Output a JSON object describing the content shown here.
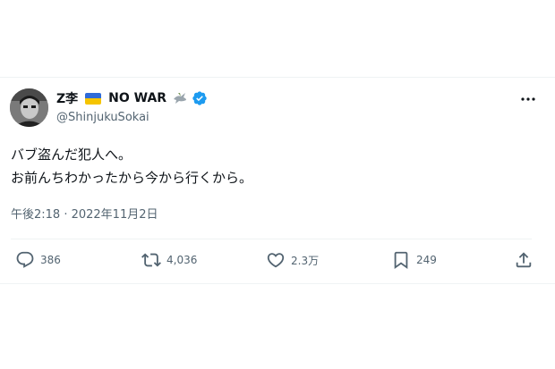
{
  "author": {
    "display_name": "Z李",
    "badge": "NO WAR",
    "handle": "@ShinjukuSokai",
    "flag_colors": [
      "#2f6bd8",
      "#f5c400"
    ],
    "verified_color": "#1d9bf0"
  },
  "post": {
    "lines": [
      "バブ盗んだ犯人へ。",
      "お前んちわかったから今から行くから。"
    ],
    "timestamp": "午後2:18 · 2022年11月2日"
  },
  "actions": {
    "reply": {
      "icon": "reply-icon",
      "count": "386"
    },
    "repost": {
      "icon": "repost-icon",
      "count": "4,036"
    },
    "like": {
      "icon": "heart-icon",
      "count": "2.3万"
    },
    "bookmark": {
      "icon": "bookmark-icon",
      "count": "249"
    },
    "share": {
      "icon": "share-icon"
    }
  },
  "colors": {
    "text": "#0f1419",
    "secondary": "#536471",
    "divider": "#eff3f4"
  }
}
